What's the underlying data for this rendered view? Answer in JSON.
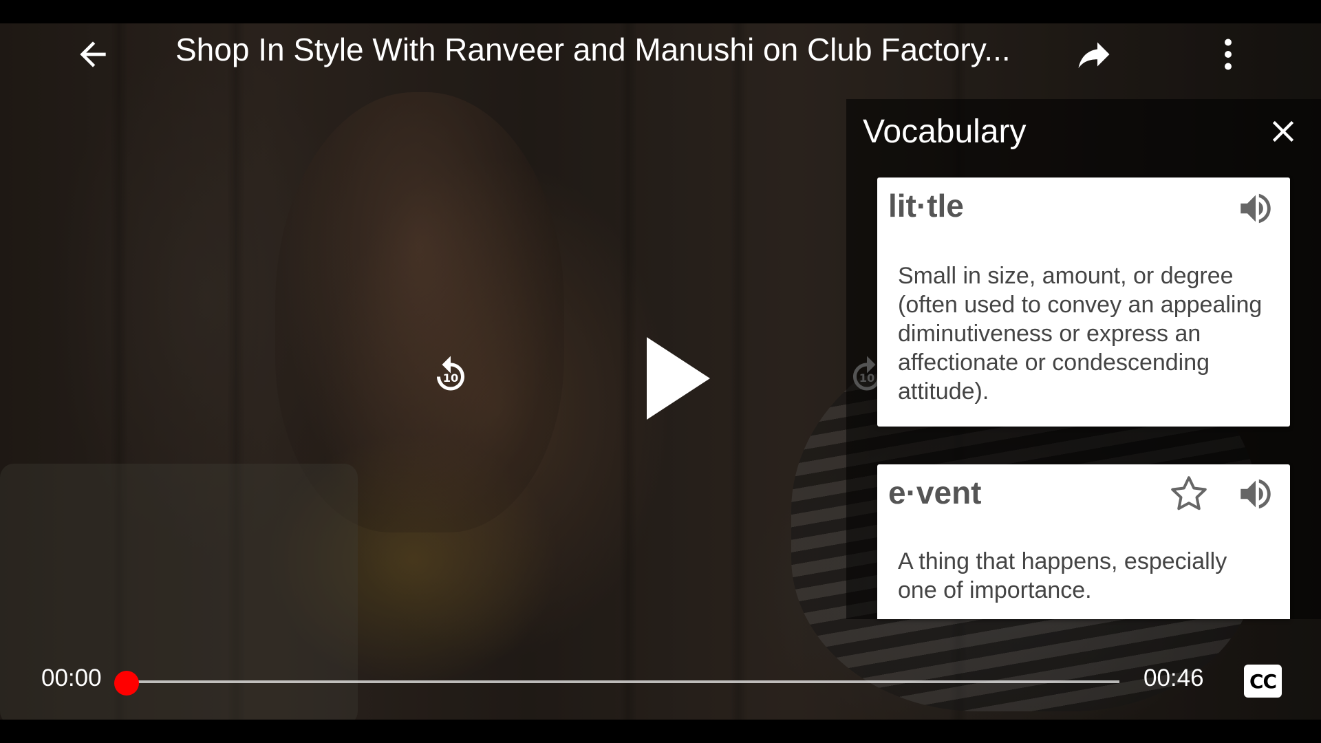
{
  "video": {
    "title": "Shop In Style With Ranveer and Manushi on Club Factory...",
    "current_time": "00:00",
    "duration": "00:46",
    "progress": 0.0,
    "rewind_seconds": "10",
    "forward_seconds": "10"
  },
  "icons": {
    "back": "back-arrow-icon",
    "share": "share-icon",
    "more": "more-vertical-icon",
    "play": "play-icon",
    "rewind": "rewind-10-icon",
    "forward": "forward-10-icon",
    "close": "close-icon",
    "speaker": "speaker-icon",
    "star": "star-outline-icon",
    "captions": "closed-captions-icon"
  },
  "vocabulary": {
    "title": "Vocabulary",
    "entries": [
      {
        "word": "lit·tle",
        "definition": "Small in size, amount, or degree (often used to convey an appealing diminutiveness or express an affectionate or condescending attitude)."
      },
      {
        "word": "e·vent",
        "definition": "A thing that happens, especially one of importance."
      }
    ]
  },
  "captions": {
    "label": "CC"
  },
  "colors": {
    "progress_thumb": "#ff0000",
    "panel_bg": "rgba(0,0,0,0.55)",
    "card_bg": "#ffffff"
  }
}
